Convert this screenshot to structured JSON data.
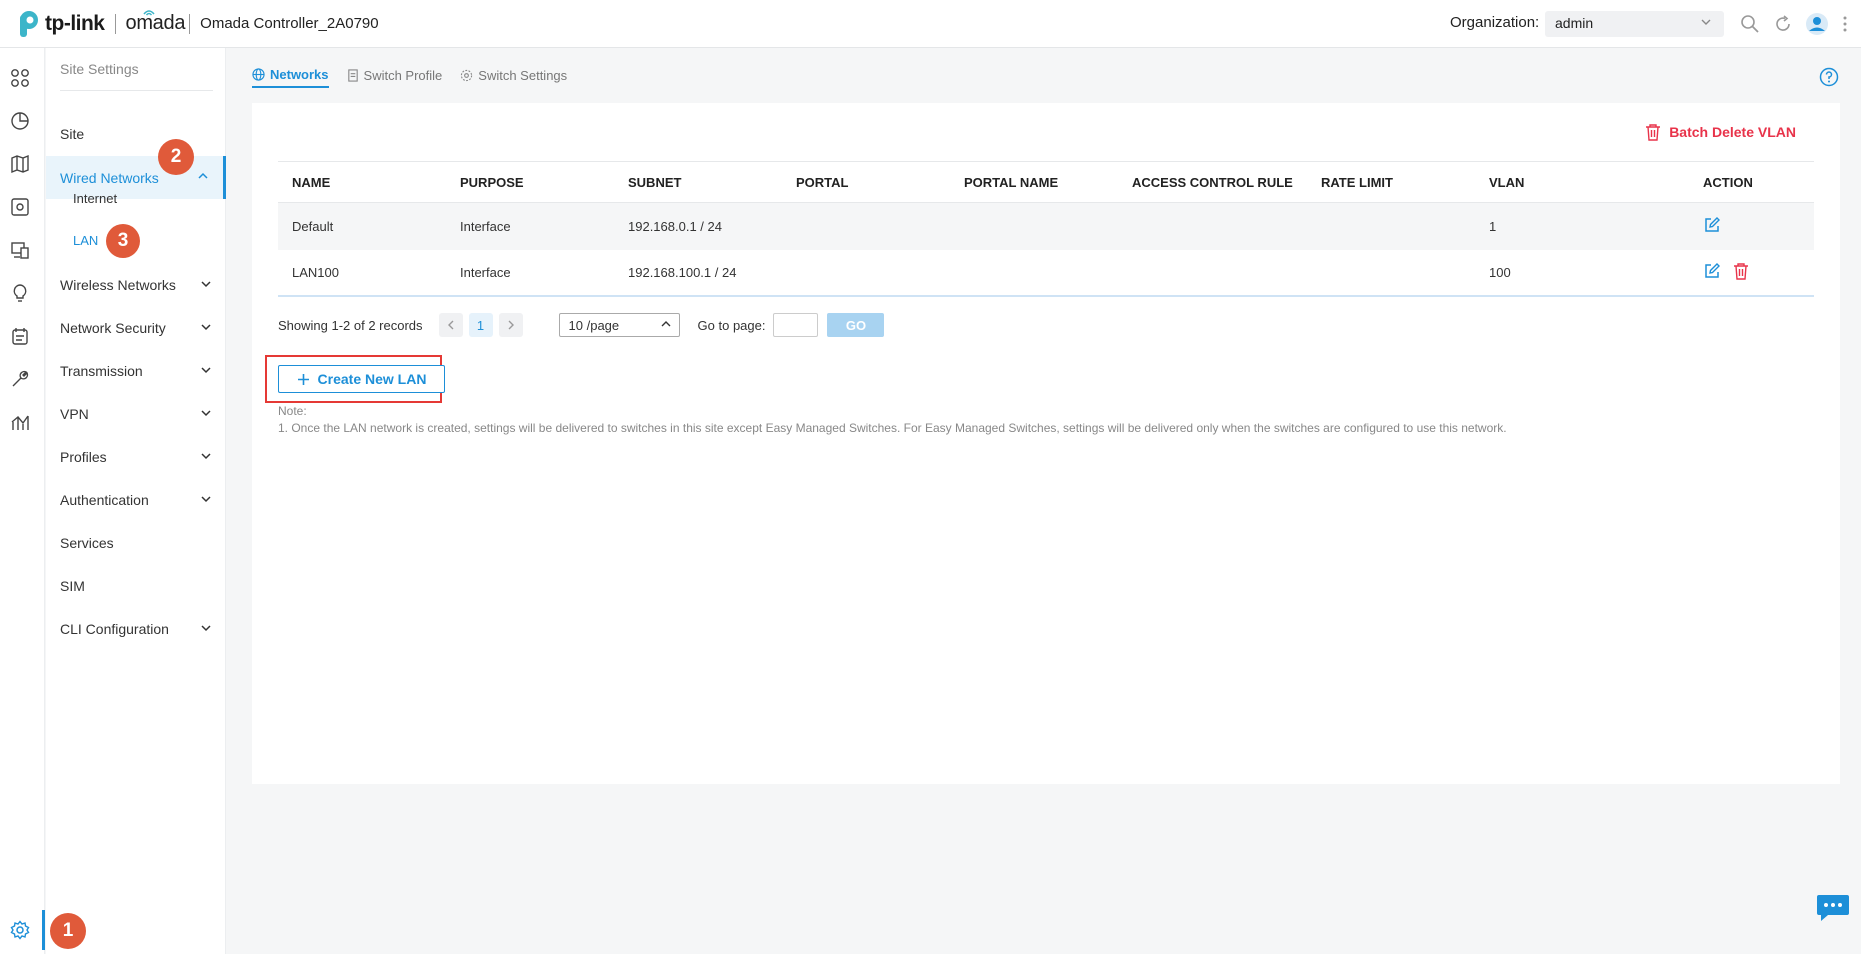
{
  "header": {
    "logo_tp": "tp-link",
    "logo_omada": "omada",
    "controller_name": "Omada Controller_2A0790",
    "org_label": "Organization:",
    "org_value": "admin"
  },
  "sidebar": {
    "title": "Site Settings",
    "items": [
      {
        "label": "Site"
      },
      {
        "label": "Wired Networks"
      },
      {
        "label": "Internet"
      },
      {
        "label": "LAN"
      },
      {
        "label": "Wireless Networks"
      },
      {
        "label": "Network Security"
      },
      {
        "label": "Transmission"
      },
      {
        "label": "VPN"
      },
      {
        "label": "Profiles"
      },
      {
        "label": "Authentication"
      },
      {
        "label": "Services"
      },
      {
        "label": "SIM"
      },
      {
        "label": "CLI Configuration"
      }
    ]
  },
  "badges": [
    "1",
    "2",
    "3"
  ],
  "tabs": [
    {
      "label": "Networks"
    },
    {
      "label": "Switch Profile"
    },
    {
      "label": "Switch Settings"
    }
  ],
  "card": {
    "batch_delete": "Batch Delete VLAN",
    "columns": [
      "NAME",
      "PURPOSE",
      "SUBNET",
      "PORTAL",
      "PORTAL NAME",
      "ACCESS CONTROL RULE",
      "RATE LIMIT",
      "VLAN",
      "ACTION"
    ],
    "rows": [
      {
        "name": "Default",
        "purpose": "Interface",
        "subnet": "192.168.0.1 / 24",
        "portal": "",
        "portal_name": "",
        "acl": "",
        "rate_limit": "",
        "vlan": "1"
      },
      {
        "name": "LAN100",
        "purpose": "Interface",
        "subnet": "192.168.100.1 / 24",
        "portal": "",
        "portal_name": "",
        "acl": "",
        "rate_limit": "",
        "vlan": "100"
      }
    ],
    "pagination": {
      "summary": "Showing 1-2 of 2 records",
      "current_page": "1",
      "page_size": "10 /page",
      "goto_label": "Go to page:",
      "go": "GO"
    },
    "create_button": "Create New LAN",
    "note_title": "Note:",
    "note_text": "1. Once the LAN network is created, settings will be delivered to switches in this site except Easy Managed Switches. For Easy Managed Switches, settings will be delivered only when the switches are configured to use this network."
  },
  "colors": {
    "accent": "#1d8fd8",
    "danger": "#e8334a",
    "badge": "#e05a3a",
    "highlight": "#e53935"
  }
}
